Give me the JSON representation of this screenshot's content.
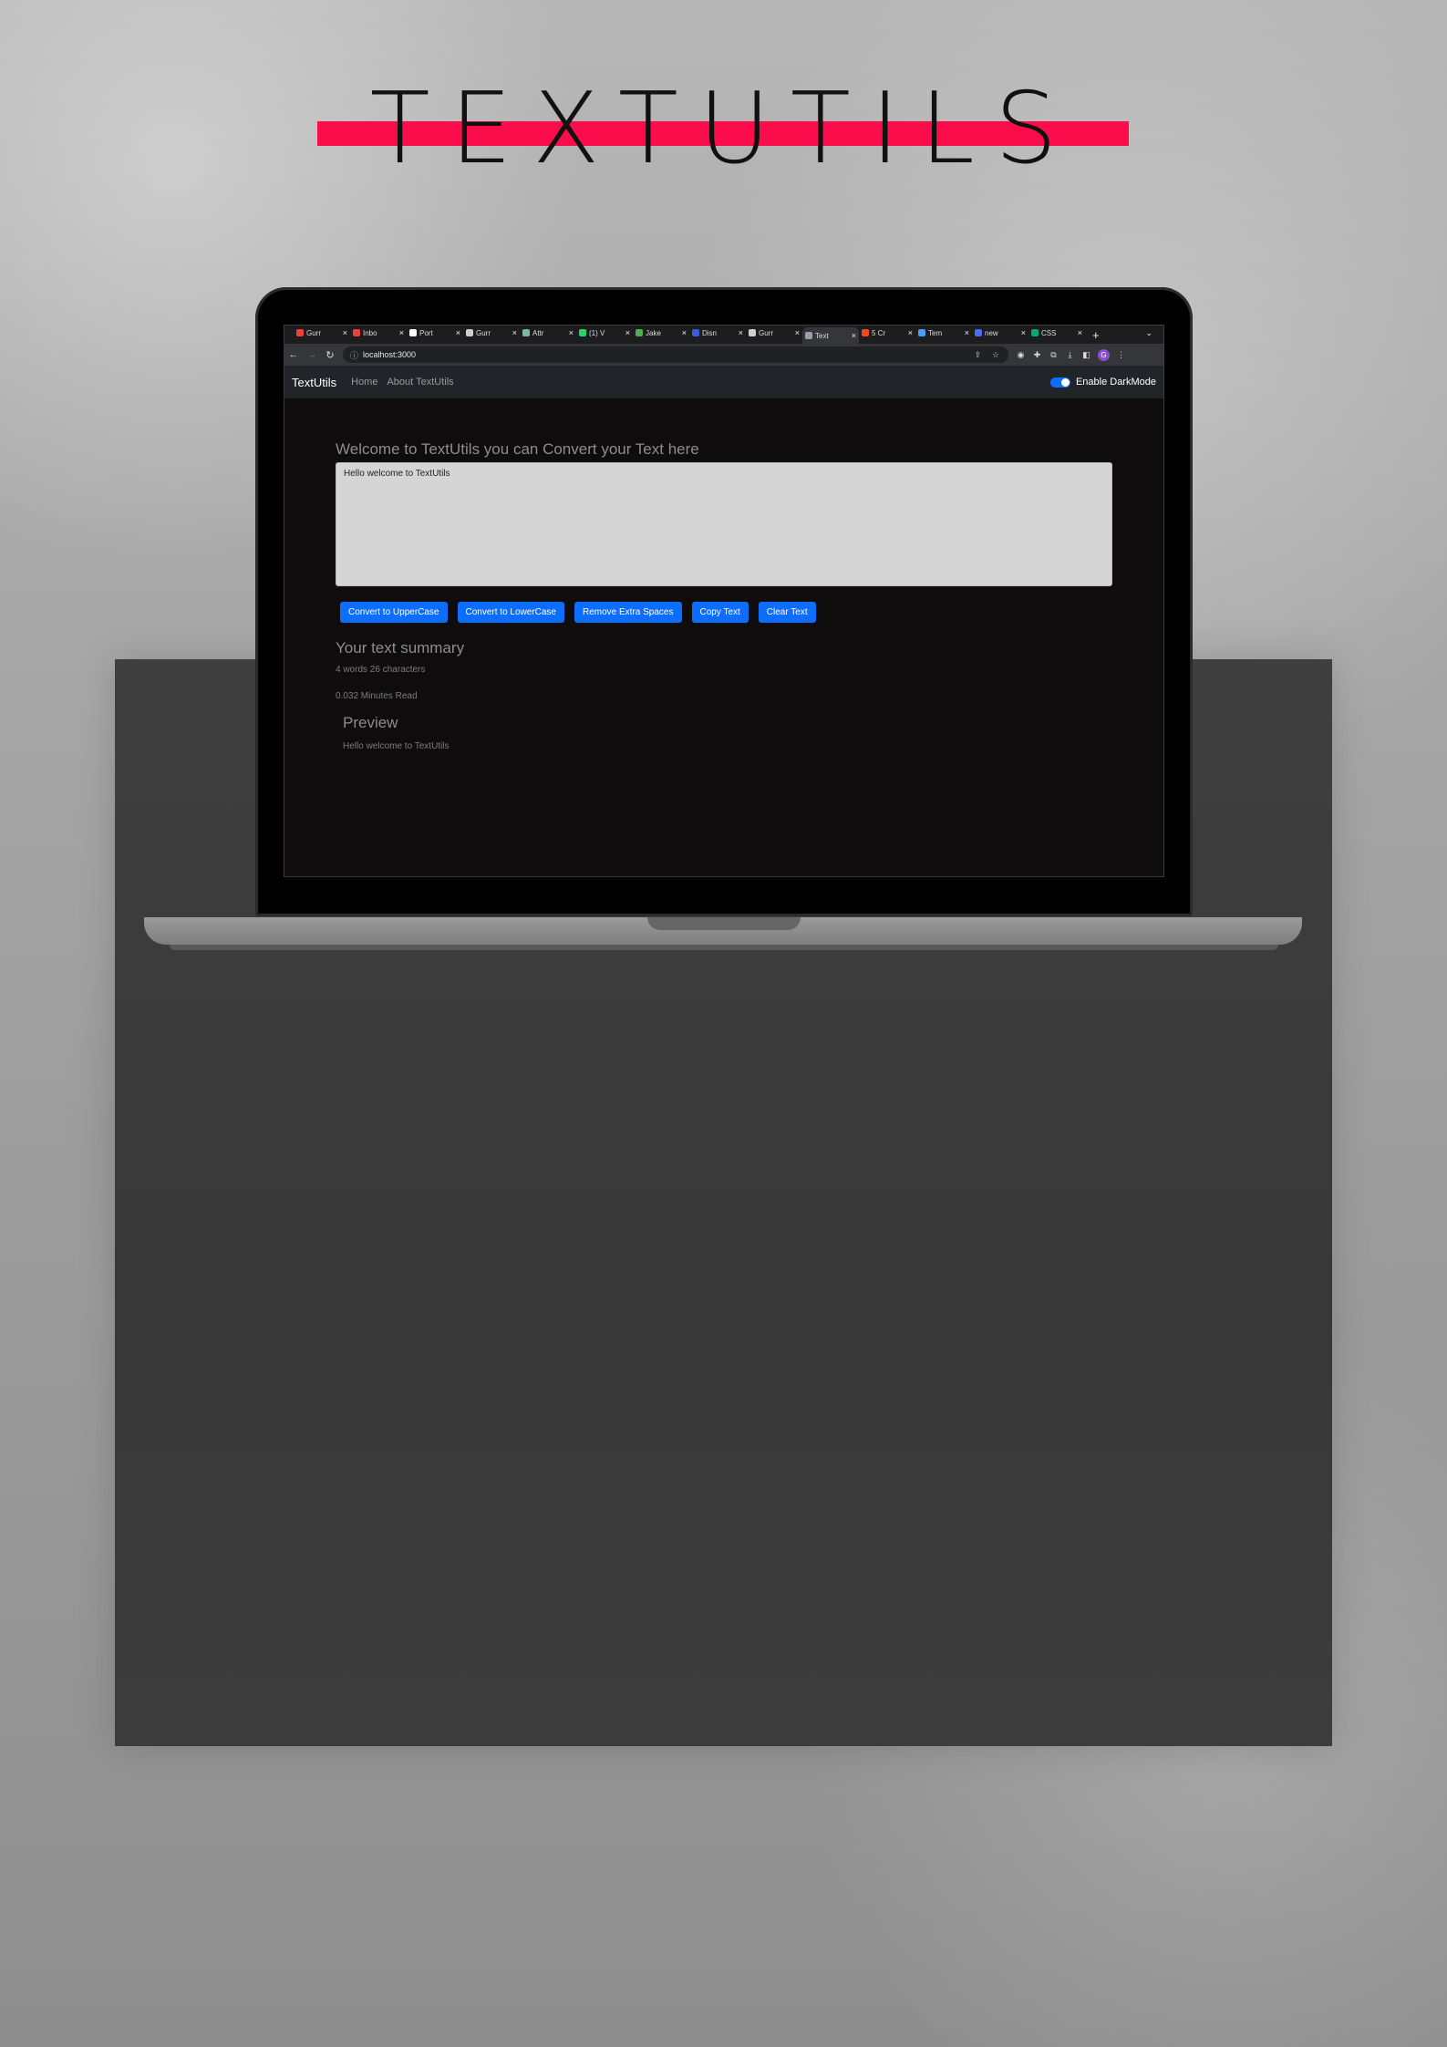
{
  "hero": {
    "title": "TEXTUTILS",
    "stripe_color": "#fa0d4a"
  },
  "browser": {
    "tabs": [
      {
        "title": "Gurr",
        "fav_color": "#ea4335",
        "icon": "gmail-icon"
      },
      {
        "title": "Inbo",
        "fav_color": "#ea4335",
        "icon": "gmail-icon"
      },
      {
        "title": "Port",
        "fav_color": "#ffffff",
        "icon": "github-icon"
      },
      {
        "title": "Gurr",
        "fav_color": "#cfcfcf",
        "icon": "globe-icon"
      },
      {
        "title": "Attr",
        "fav_color": "#7fb4a6",
        "icon": "sheet-icon"
      },
      {
        "title": "(1) V",
        "fav_color": "#25d366",
        "icon": "whatsapp-icon"
      },
      {
        "title": "Jake",
        "fav_color": "#4caf50",
        "icon": "leaf-icon"
      },
      {
        "title": "Disn",
        "fav_color": "#3b5bdb",
        "icon": "disney-icon"
      },
      {
        "title": "Gurr",
        "fav_color": "#cfcfcf",
        "icon": "globe-icon"
      },
      {
        "title": "Text",
        "fav_color": "#9aa0a6",
        "icon": "page-icon",
        "active": true
      },
      {
        "title": "5 Cr",
        "fav_color": "#f04a23",
        "icon": "bookmark-icon"
      },
      {
        "title": "Tem",
        "fav_color": "#4a9df0",
        "icon": "chrome-icon"
      },
      {
        "title": "new",
        "fav_color": "#4a6cf0",
        "icon": "search-icon"
      },
      {
        "title": "CSS",
        "fav_color": "#04aa6d",
        "icon": "w3-icon"
      }
    ],
    "close_glyph": "×",
    "new_tab_glyph": "+",
    "tab_menu_glyph": "⌄",
    "url": "localhost:3000",
    "back_glyph": "←",
    "forward_glyph": "→",
    "reload_glyph": "↻",
    "info_glyph": "ⓘ",
    "share_glyph": "⇪",
    "star_glyph": "☆",
    "ext_glyphs": [
      "◉",
      "✚",
      "⧉",
      "⤓",
      "◧",
      "⋮"
    ],
    "avatar_letter": "G"
  },
  "app": {
    "brand": "TextUtils",
    "nav": {
      "home": "Home",
      "about": "About TextUtils"
    },
    "darkmode_label": "Enable DarkMode",
    "heading": "Welcome to TextUtils you can Convert your Text here",
    "text_value": "Hello welcome to TextUtils",
    "buttons": {
      "upper": "Convert to UpperCase",
      "lower": "Convert to LowerCase",
      "spaces": "Remove Extra Spaces",
      "copy": "Copy Text",
      "clear": "Clear Text"
    },
    "summary_title": "Your text summary",
    "summary_counts": "4 words 26 characters",
    "summary_read": "0.032 Minutes Read",
    "preview_title": "Preview",
    "preview_text": "Hello welcome to TextUtils",
    "accent_color": "#0d6efd"
  }
}
